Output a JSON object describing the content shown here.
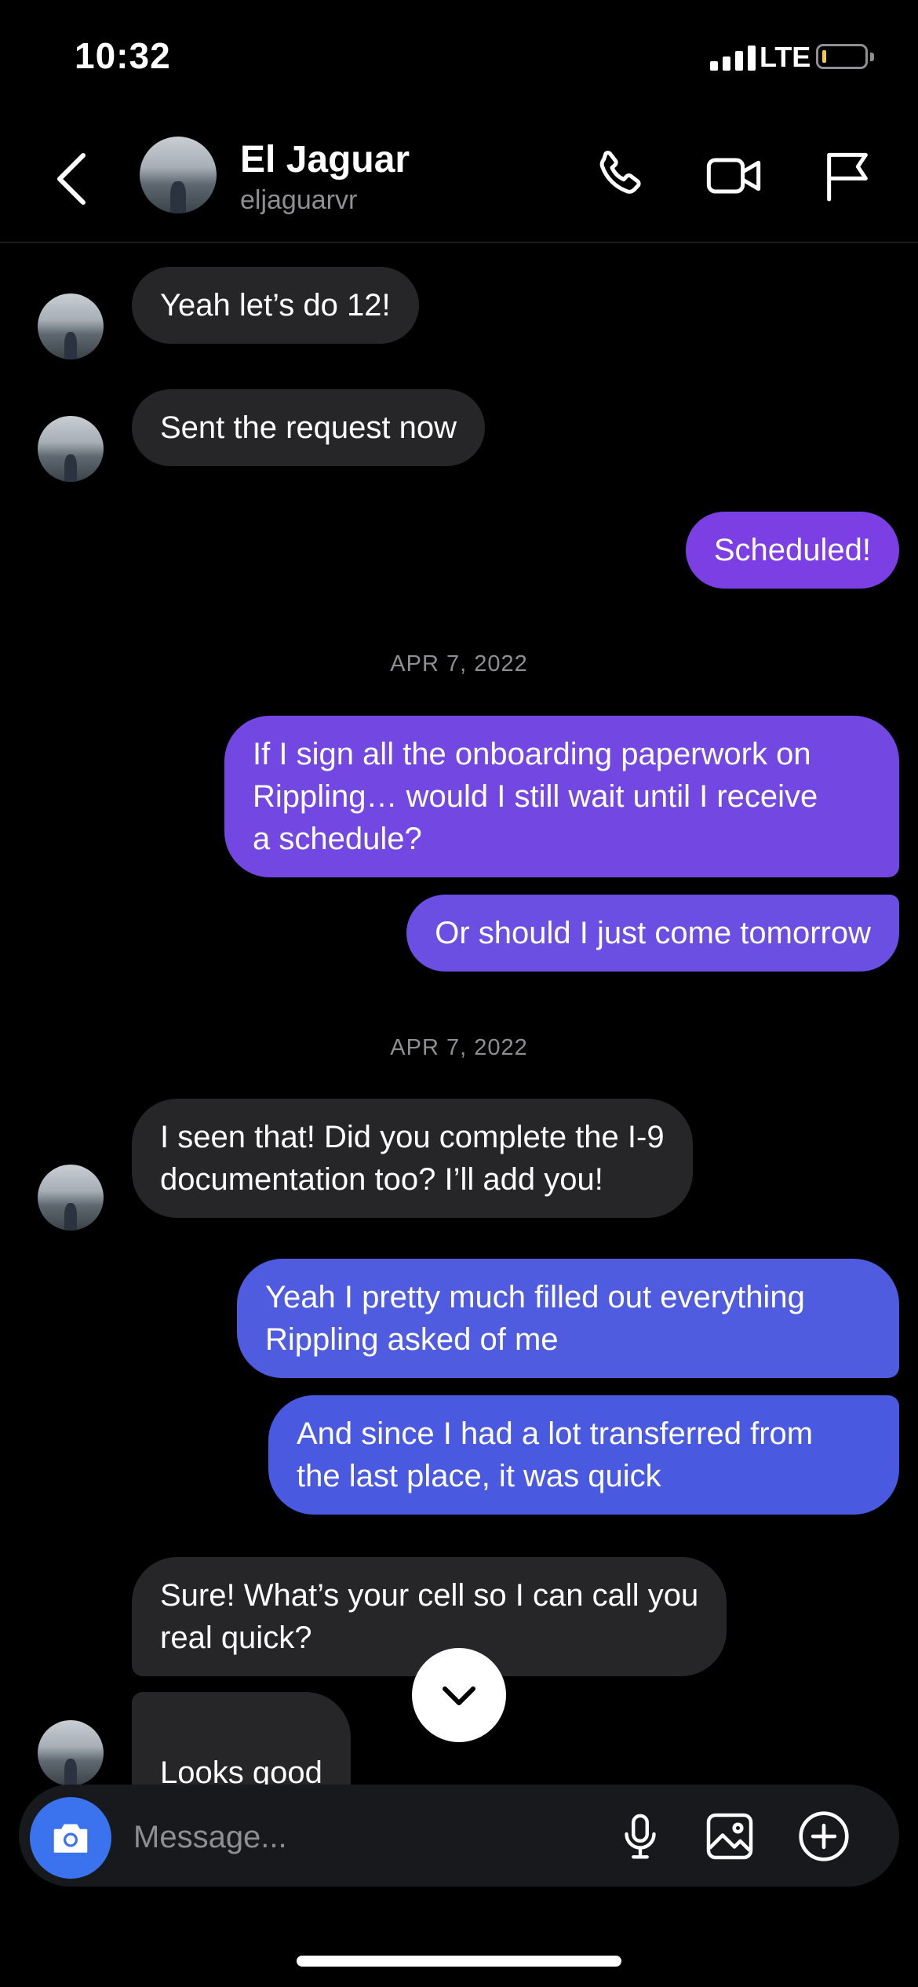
{
  "status_bar": {
    "time": "10:32",
    "network": "LTE"
  },
  "header": {
    "name": "El Jaguar",
    "username": "eljaguarvr"
  },
  "messages": [
    {
      "side": "in",
      "text": "Yeah let’s do 12!"
    },
    {
      "side": "in",
      "text": "Sent the request now"
    },
    {
      "side": "out",
      "text": "Scheduled!"
    },
    {
      "type": "date",
      "text": "APR 7, 2022"
    },
    {
      "side": "out",
      "text": "If I sign all the onboarding paperwork on\nRippling… would I still wait until I receive\na schedule?"
    },
    {
      "side": "out",
      "text": "Or should I just come tomorrow"
    },
    {
      "type": "date",
      "text": "APR 7, 2022"
    },
    {
      "side": "in",
      "text": "I seen that! Did you complete the I-9\ndocumentation too? I’ll add you!"
    },
    {
      "side": "out",
      "text": "Yeah I pretty much filled out everything\nRippling asked of me"
    },
    {
      "side": "out",
      "text": "And since I had a lot transferred from\nthe last place, it was quick"
    },
    {
      "side": "in",
      "text": "Sure! What’s your cell so I can call you\nreal quick?"
    },
    {
      "side": "in",
      "text": "Looks good",
      "emoji": "👍🏽"
    }
  ],
  "composer": {
    "placeholder": "Message..."
  },
  "colors": {
    "accent_blue": "#3b73ee",
    "outgoing_purple": "#7b3fe4",
    "outgoing_indigo": "#4a5ae0",
    "incoming_bubble": "#262628"
  },
  "icons": [
    "back-chevron-icon",
    "phone-icon",
    "video-camera-icon",
    "flag-icon",
    "camera-icon",
    "microphone-icon",
    "image-icon",
    "plus-circle-icon",
    "chevron-down-icon"
  ]
}
